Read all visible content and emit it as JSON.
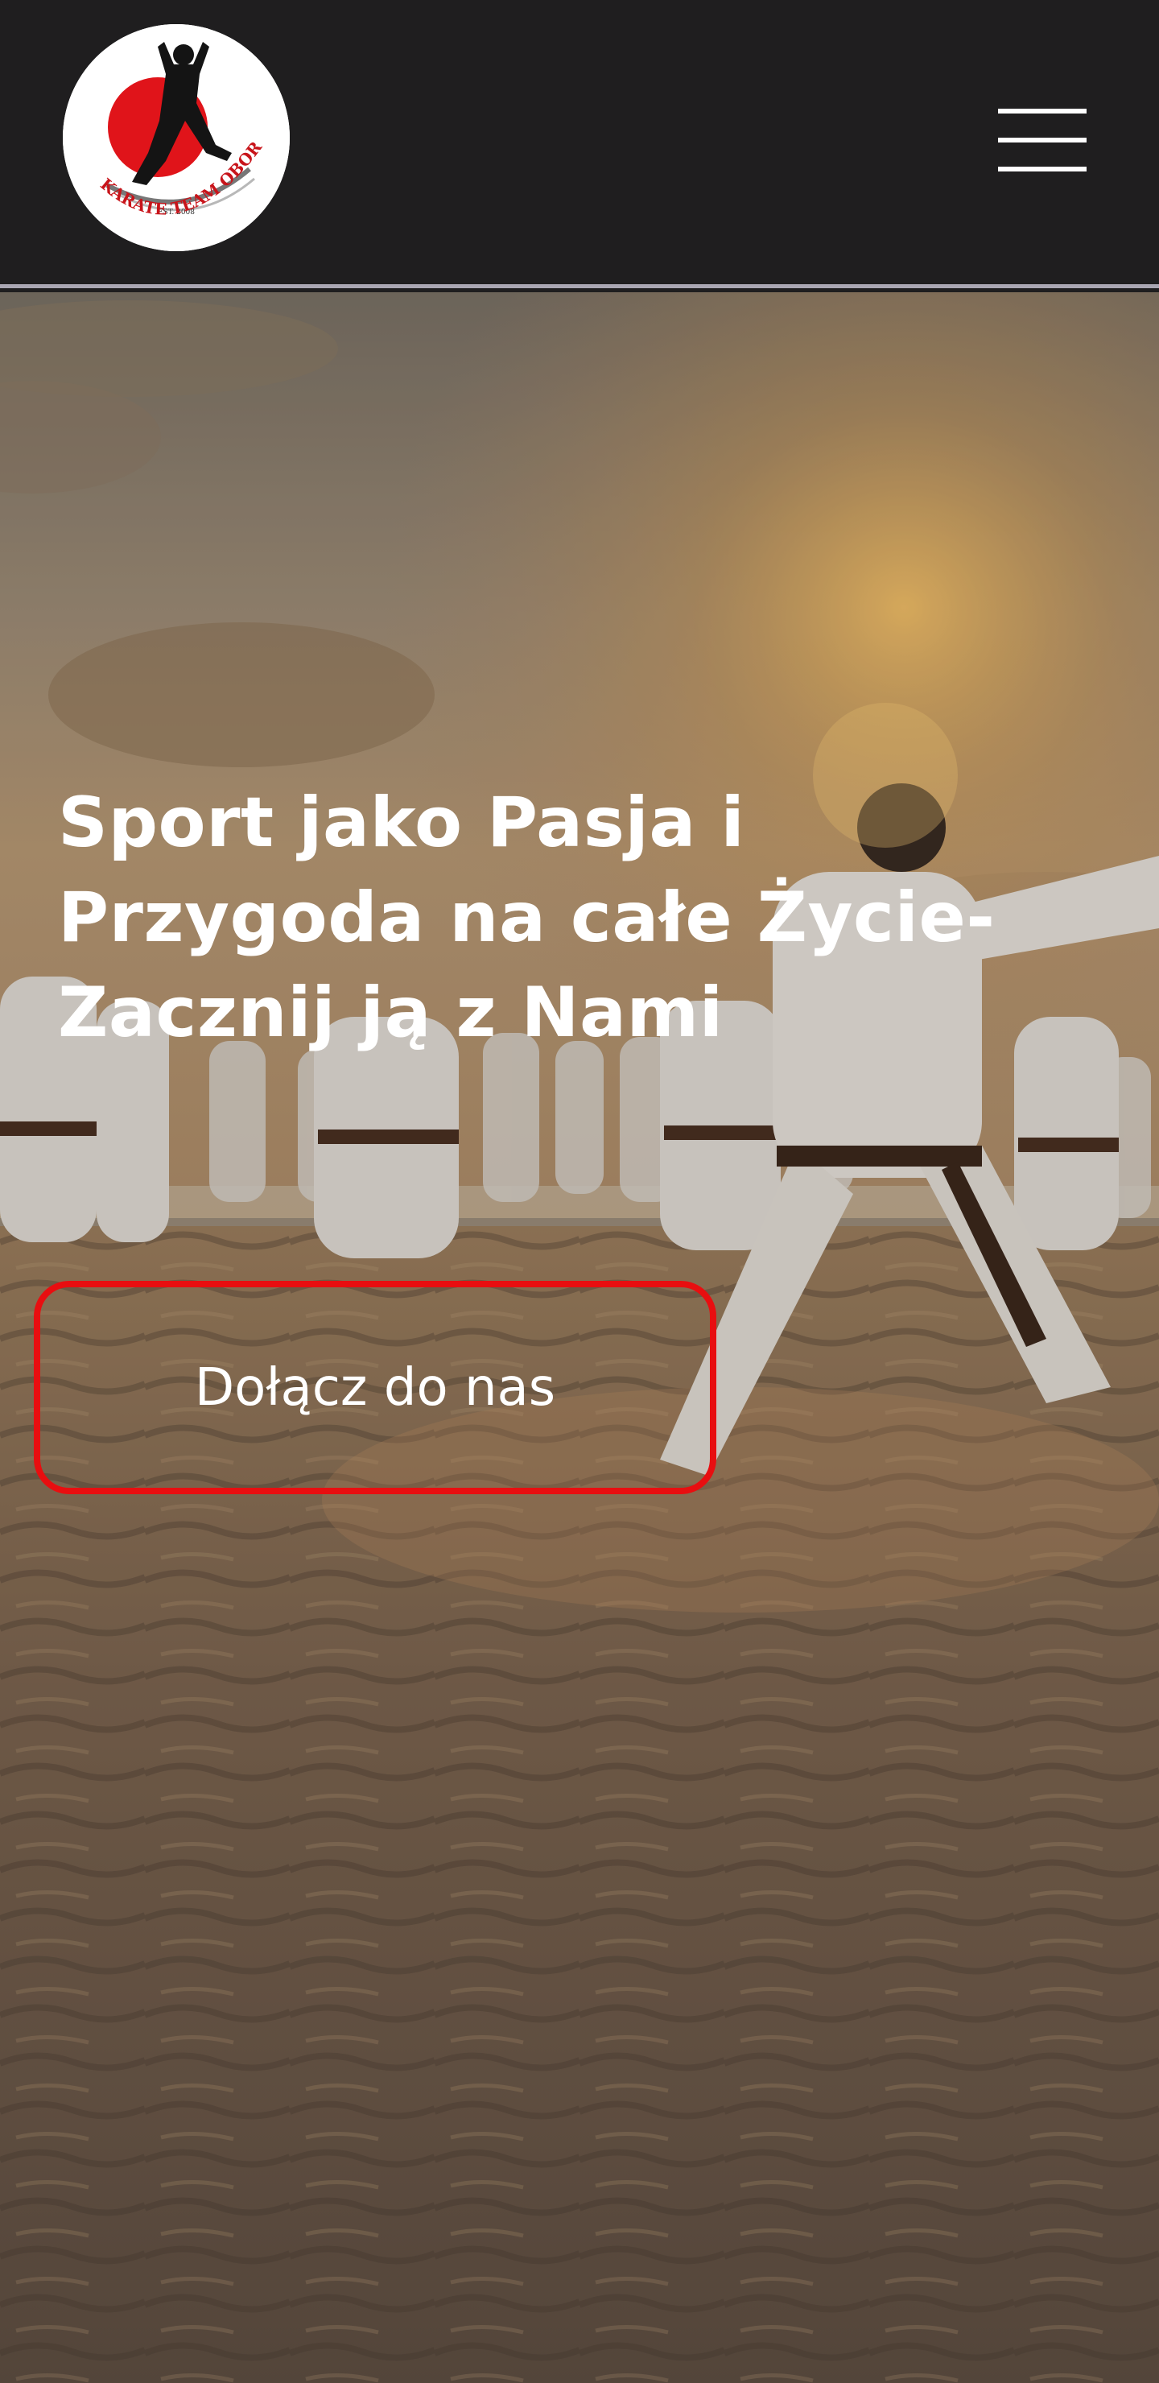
{
  "header": {
    "logo": {
      "name": "Karate Team Oborniki logo",
      "text_top": "EST. 2008",
      "text_arc": "KARATE TEAM OBORNIKI",
      "accent": "#e0141a"
    },
    "menu_icon": "hamburger-icon"
  },
  "hero": {
    "headline_lines": [
      "Sport jako Pasja i",
      "Przygoda na całe Życie-",
      "Zacznij ją z Nami"
    ],
    "cta_label": "Dołącz do nas"
  },
  "colors": {
    "header_bg": "#1f1e1f",
    "header_border": "#a9a6b2",
    "cta_border": "#e80e10",
    "text": "#ffffff"
  }
}
